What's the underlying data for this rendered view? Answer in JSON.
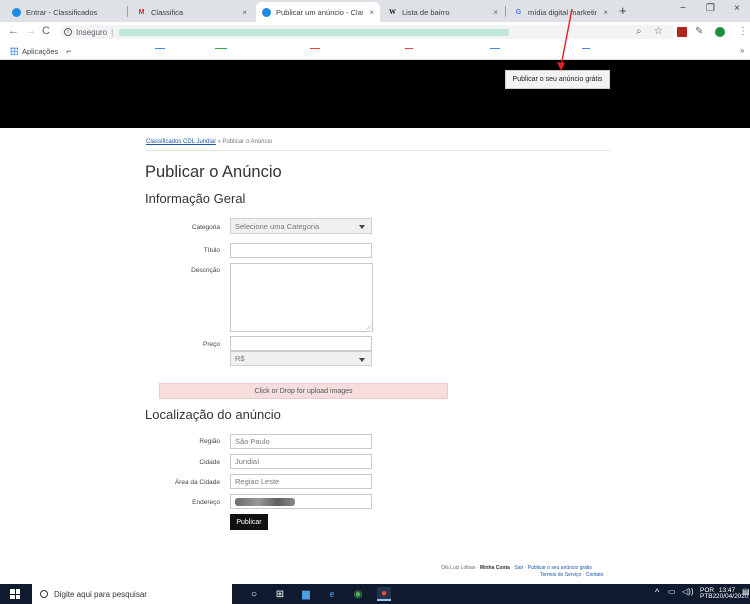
{
  "browser": {
    "tabs": [
      {
        "label": "Entrar - Classificados",
        "icon": "site-favicon",
        "close": ""
      },
      {
        "label": "Classifica",
        "icon": "gmail-icon",
        "close": "×"
      },
      {
        "label": "Publicar um anúncio - Clas",
        "icon": "site-favicon",
        "close": "×"
      },
      {
        "label": "Lista de bairro",
        "icon": "wikipedia-icon",
        "close": "×"
      },
      {
        "label": "mídia digital marketing - R",
        "icon": "google-icon",
        "close": "×"
      }
    ],
    "new_tab": "+",
    "window_controls": {
      "minimize": "−",
      "maximize": "❐",
      "close": "×"
    },
    "address": {
      "security_label": "Inseguro"
    },
    "bookmarks": {
      "apps_label": "Aplicações"
    }
  },
  "header": {
    "publish_button": "Publicar o seu anúncio grátis"
  },
  "breadcrumb": {
    "home": "Classificados CDL Jundiaí",
    "separator": " » ",
    "current": "Publicar o Anúncio"
  },
  "form": {
    "title": "Publicar o Anúncio",
    "general_heading": "Informação Geral",
    "category": {
      "label": "Categoria",
      "value": "Selecione uma Categoria"
    },
    "title_field": {
      "label": "Título",
      "value": ""
    },
    "description": {
      "label": "Descrição",
      "value": ""
    },
    "price": {
      "label": "Preço",
      "value": "",
      "currency": "R$"
    },
    "upload_text": "Click or Drop for upload images",
    "location_heading": "Localização do anúncio",
    "region": {
      "label": "Região",
      "value": "São Paulo"
    },
    "city": {
      "label": "Cidade",
      "value": "Jundiaí"
    },
    "city_area": {
      "label": "Área da Cidade",
      "value": "Regiao Leste"
    },
    "address": {
      "label": "Endereço"
    },
    "submit": "Publicar"
  },
  "footer": {
    "greeting": "Olá Luiz Lolivar ·",
    "my_account": "Minha Conta",
    "logout": "Sair",
    "publish": "Publicar o seu anúncio grátis",
    "terms": "Termos do Serviço",
    "contact": "Contato"
  },
  "taskbar": {
    "search_placeholder": "Digite aqui para pesquisar",
    "language": "POR",
    "layout": "PTB2",
    "time": "13:47",
    "date": "20/04/2020"
  }
}
